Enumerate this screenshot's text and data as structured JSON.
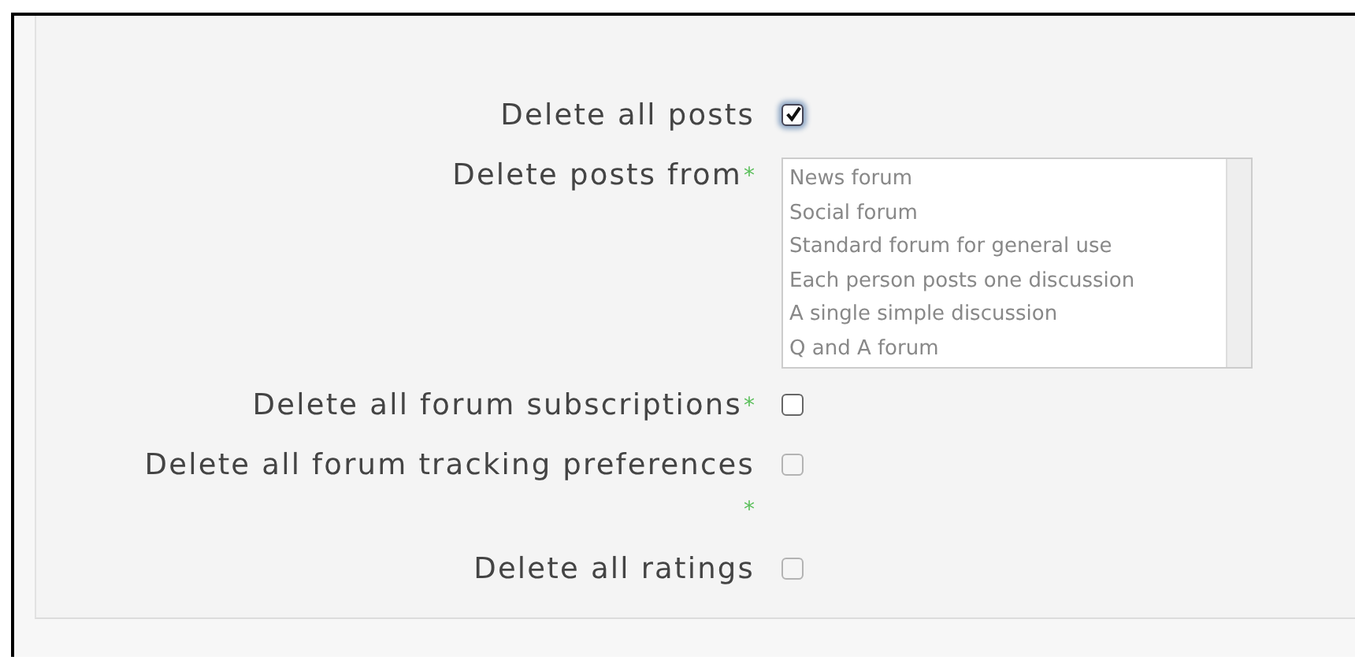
{
  "fields": [
    {
      "kind": "checkbox",
      "label": "Delete all posts",
      "checked": true,
      "focused": true,
      "disabled": false
    },
    {
      "kind": "listbox",
      "label": "Delete posts from",
      "required_mark": "*",
      "options": [
        "News forum",
        "Social forum",
        "Standard forum for general use",
        "Each person posts one discussion",
        "A single simple discussion",
        "Q and A forum"
      ]
    },
    {
      "kind": "checkbox",
      "label": "Delete all forum subscriptions",
      "required_mark": "*",
      "checked": false,
      "focused": false,
      "disabled": false
    },
    {
      "kind": "checkbox",
      "label": "Delete all forum tracking preferences",
      "required_mark": "*",
      "checked": false,
      "focused": false,
      "disabled": true
    },
    {
      "kind": "checkbox",
      "label": "Delete all ratings",
      "checked": false,
      "focused": false,
      "disabled": true
    }
  ]
}
